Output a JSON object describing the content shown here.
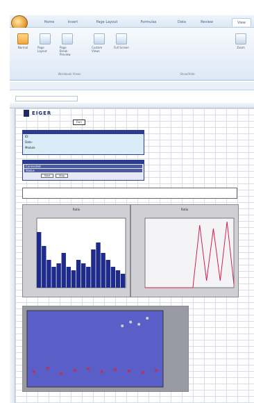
{
  "ribbon": {
    "tabs": [
      "Home",
      "Insert",
      "Page Layout",
      "Formulas",
      "Data",
      "Review",
      "View"
    ],
    "active_tab": 6,
    "buttons": [
      "Normal",
      "Page Layout",
      "Page Break Preview",
      "Custom Views",
      "Full Screen",
      "Zoom"
    ],
    "groups": [
      "Workbook Views",
      "Show/Hide"
    ]
  },
  "sheet": {
    "logo_text": "EIGER",
    "button_label": "Run",
    "info_lines": [
      "ID:",
      "Date:",
      "Module"
    ],
    "panel_lines": [
      "Connected",
      "Status"
    ],
    "panel_buttons": [
      "Start",
      "Stop"
    ],
    "chart1_title": "Ratio",
    "chart2_title": "Ratio"
  },
  "chart_data": [
    {
      "type": "bar",
      "title": "Ratio",
      "values": [
        0.8,
        0.6,
        0.4,
        0.3,
        0.35,
        0.5,
        0.3,
        0.25,
        0.4,
        0.35,
        0.3,
        0.55,
        0.65,
        0.5,
        0.4,
        0.3,
        0.25,
        0.2
      ],
      "colors": [
        "#1f2b8a",
        "#ffffff"
      ]
    },
    {
      "type": "line",
      "title": "Ratio",
      "series": [
        {
          "values": [
            0,
            0,
            0,
            0,
            0,
            0,
            0,
            0,
            0.9,
            0.1,
            0.85,
            0.1,
            0.95,
            0.05
          ]
        }
      ],
      "colors": [
        "#d02050"
      ]
    },
    {
      "type": "scatter",
      "series": [
        {
          "values": [
            0.2,
            0.25,
            0.18,
            0.22,
            0.24,
            0.2,
            0.23,
            0.21,
            0.19,
            0.22
          ]
        },
        {
          "values": [
            0.8,
            0.85,
            0.82,
            0.9
          ]
        }
      ],
      "colors": [
        "#c03050",
        "#cfcfd4"
      ]
    }
  ]
}
